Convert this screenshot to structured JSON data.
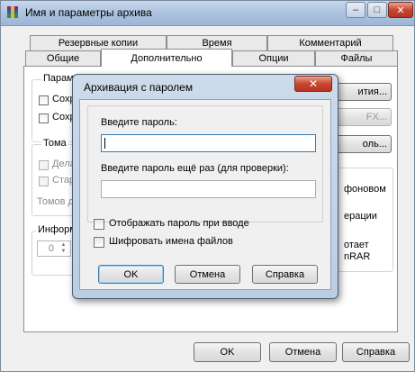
{
  "window": {
    "title": "Имя и параметры архива",
    "caption_buttons": {
      "minimize": "–",
      "maximize": "□",
      "close": "✕"
    }
  },
  "tabs_row_back": [
    "Резервные копии",
    "Время",
    "Комментарий"
  ],
  "tabs_row_front": [
    "Общие",
    "Дополнительно",
    "Опции",
    "Файлы"
  ],
  "active_tab": "Дополнительно",
  "background": {
    "params_group_label": "Параметры",
    "params_check1": "Сохра",
    "params_check2": "Сохра",
    "right_btn1": "ития...",
    "right_btn2": "FX...",
    "right_btn3": "оль...",
    "volumes_group_label": "Тома",
    "volumes_check1": "Дела",
    "volumes_check2": "Стары",
    "volumes_text": "Томов д",
    "info_group_label": "Информа",
    "right_text1": "фоновом",
    "right_text2": "ерации",
    "right_text3": "отает",
    "right_text4": "nRAR",
    "spin_value": "0"
  },
  "bottom_buttons": {
    "ok": "OK",
    "cancel": "Отмена",
    "help": "Справка"
  },
  "dialog": {
    "title": "Архивация с паролем",
    "close_glyph": "✕",
    "password_label": "Введите пароль:",
    "password_value": "",
    "confirm_label": "Введите пароль ещё раз (для проверки):",
    "confirm_value": "",
    "show_password_label": "Отображать пароль при вводе",
    "show_password_checked": false,
    "encrypt_names_label": "Шифровать имена файлов",
    "encrypt_names_checked": false,
    "ok": "OK",
    "cancel": "Отмена",
    "help": "Справка"
  }
}
